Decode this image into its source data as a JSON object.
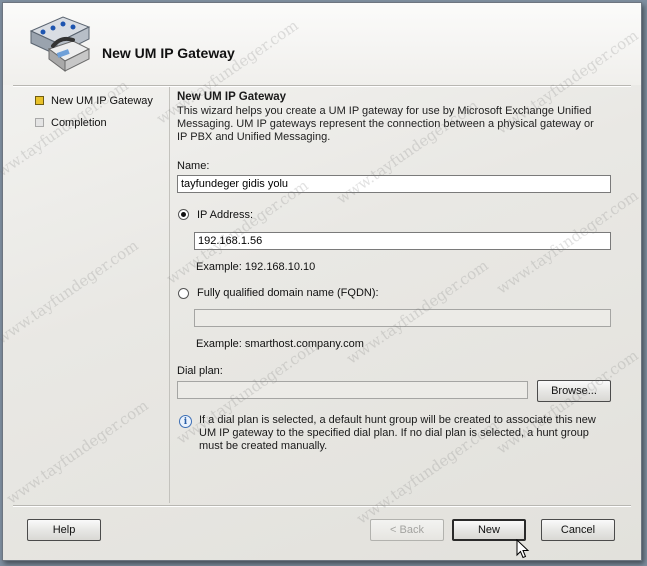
{
  "window": {
    "title": "New UM IP Gateway"
  },
  "nav": {
    "items": [
      {
        "label": "New UM IP Gateway",
        "state": "active"
      },
      {
        "label": "Completion",
        "state": "inactive"
      }
    ]
  },
  "content": {
    "title": "New UM IP Gateway",
    "description": "This wizard helps you create a UM IP gateway for use by Microsoft Exchange Unified Messaging. UM IP gateways represent the connection between a physical gateway or IP PBX and Unified Messaging.",
    "name_label": "Name:",
    "name_value": "tayfundeger gidis yolu",
    "ip_option_label": "IP Address:",
    "ip_value": "192.168.1.56",
    "ip_example": "Example: 192.168.10.10",
    "fqdn_option_label": "Fully qualified domain name (FQDN):",
    "fqdn_value": "",
    "fqdn_example": "Example: smarthost.company.com",
    "dialplan_label": "Dial plan:",
    "dialplan_value": "",
    "browse_label": "Browse...",
    "info_text": "If a dial plan is selected, a default hunt group will be created to associate this new UM IP gateway to the specified dial plan. If no dial plan is selected, a hunt group must be created manually."
  },
  "footer": {
    "help_label": "Help",
    "back_label": "< Back",
    "new_label": "New",
    "cancel_label": "Cancel"
  },
  "watermark": "www.tayfundeger.com",
  "colors": {
    "active_step": "#e8c12a",
    "inactive_step": "#e4e4e4"
  }
}
